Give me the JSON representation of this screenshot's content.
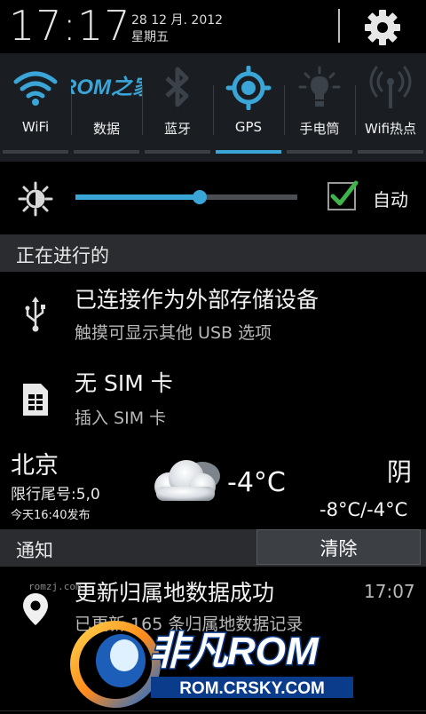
{
  "status": {
    "time": "17:17",
    "date": "28 12 月. 2012",
    "weekday": "星期五"
  },
  "toggles": [
    {
      "label": "WiFi",
      "icon": "wifi-icon",
      "on": true
    },
    {
      "label": "数据",
      "icon": "rom-logo-icon",
      "on": false
    },
    {
      "label": "蓝牙",
      "icon": "bluetooth-icon",
      "on": false
    },
    {
      "label": "GPS",
      "icon": "gps-icon",
      "on": true
    },
    {
      "label": "手电筒",
      "icon": "flashlight-icon",
      "on": false
    },
    {
      "label": "Wifi热点",
      "icon": "wifi-hotspot-icon",
      "on": false
    }
  ],
  "rom_logo_text": "ROM之家",
  "brightness": {
    "level": 0.56,
    "auto_label": "自动",
    "auto_checked": true
  },
  "ongoing": {
    "header": "正在进行的",
    "items": [
      {
        "title": "已连接作为外部存储设备",
        "subtitle": "触摸可显示其他 USB 选项",
        "icon": "usb-icon"
      },
      {
        "title": "无 SIM 卡",
        "subtitle": "插入 SIM 卡",
        "icon": "sim-card-icon"
      }
    ]
  },
  "weather": {
    "city": "北京",
    "limit": "限行尾号:5,0",
    "published": "今天16:40发布",
    "temp": "-4°C",
    "condition": "阴",
    "range": "-8°C/-4°C",
    "icon": "cloud-icon"
  },
  "notifications": {
    "header": "通知",
    "clear_label": "清除",
    "items": [
      {
        "title": "更新归属地数据成功",
        "subtitle": "已更新 165 条归属地数据记录",
        "time": "17:07",
        "icon": "location-pin-icon"
      }
    ]
  },
  "watermark": {
    "small": "romzj.com",
    "logo_main": "非凡ROM",
    "logo_url": "ROM.CRSKY.COM"
  },
  "colors": {
    "accent": "#3aa6d8",
    "panel": "#1a1d21",
    "section": "#2a2c30",
    "logo_green": "#9ee03a"
  }
}
